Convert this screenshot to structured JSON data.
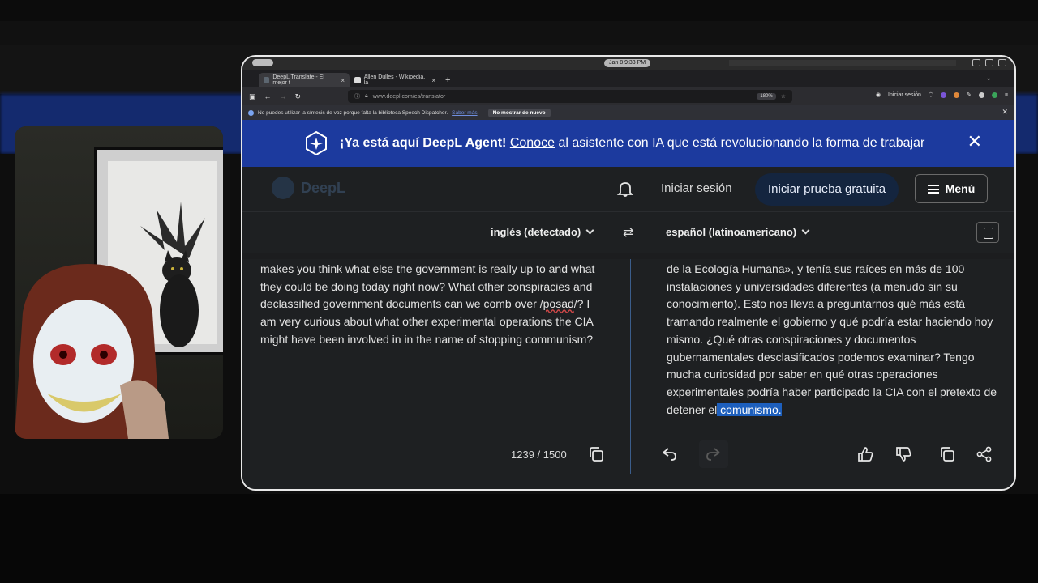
{
  "system": {
    "clock": "Jan 8    9:33 PM"
  },
  "tabs": [
    {
      "label": "DeepL Translate - El mejor t",
      "active": true
    },
    {
      "label": "Allen Dulles - Wikipedia, la",
      "active": false
    }
  ],
  "address_bar": {
    "url": "www.deepl.com/es/translator",
    "zoom": "180%",
    "sign_in": "Iniciar sesión"
  },
  "notice": {
    "text": "No puedes utilizar la síntesis de voz porque falta la biblioteca Speech Dispatcher.",
    "link": "Saber más",
    "dismiss": "No mostrar de nuevo"
  },
  "banner": {
    "headline": "¡Ya está aquí DeepL Agent!",
    "link": "Conoce",
    "rest": " al asistente con IA que está revolucionando la forma de trabajar"
  },
  "header": {
    "logo": "DeepL",
    "login": "Iniciar sesión",
    "trial": "Iniciar prueba gratuita",
    "menu": "Menú"
  },
  "languages": {
    "source": "inglés (detectado)",
    "target": "español (latinoamericano)"
  },
  "source_text": {
    "before": "makes you think what else the government is really up to and what they could be doing today right now?  What other conspiracies and declassified government documents can we comb over /",
    "misspelled": "posad",
    "after": "/? I am very curious about what other experimental operations the CIA might have been involved in in the name of stopping communism?"
  },
  "target_text": {
    "before": "de la Ecología Humana», y tenía sus raíces en más de 100 instalaciones y universidades diferentes (a menudo sin su conocimiento). Esto nos lleva a preguntarnos qué más está tramando realmente el gobierno y qué podría estar haciendo hoy mismo. ¿Qué otras conspiraciones y documentos gubernamentales desclasificados podemos examinar? Tengo mucha curiosidad por saber en qué otras operaciones experimentales podría haber participado la CIA con el pretexto de detener el",
    "highlighted": " comunismo."
  },
  "counter": "1239 / 1500",
  "colors": {
    "banner": "#1c3a9e",
    "page": "#1e2022",
    "highlight": "#1d5fbd"
  }
}
